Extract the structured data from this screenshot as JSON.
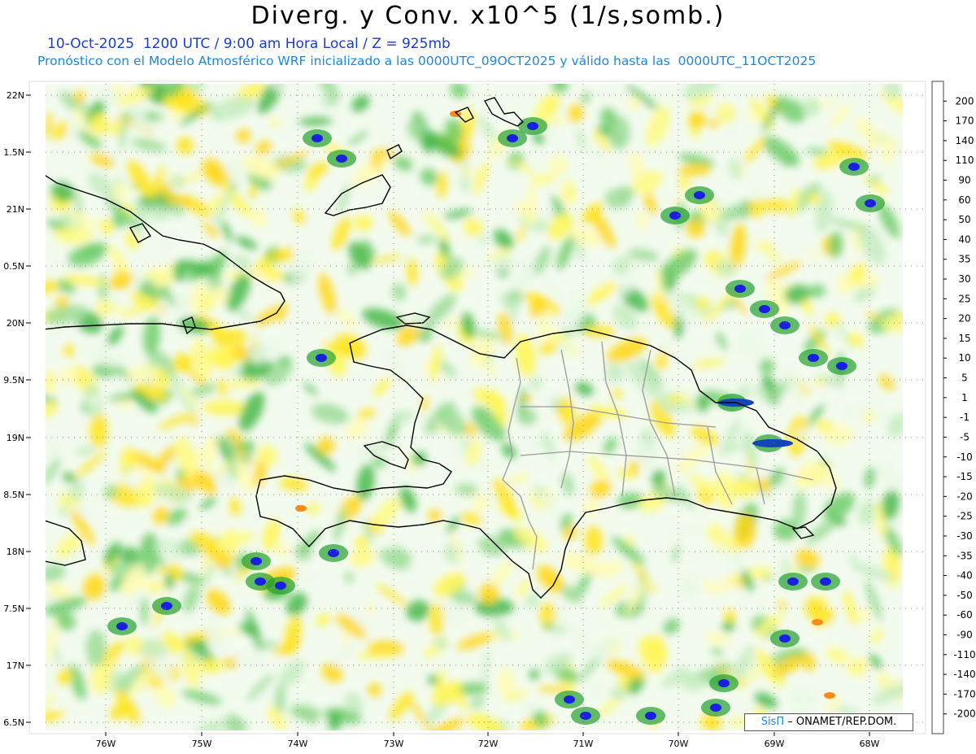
{
  "header": {
    "title": "Diverg. y Conv. x10^5 (1/s,somb.)",
    "line1": "10-Oct-2025  1200 UTC / 9:00 am Hora Local / Z = 925mb",
    "line2": "Pronóstico con el Modelo Atmosférico WRF inicializado a las 0000UTC_09OCT2025 y válido hasta las  0000UTC_11OCT2025"
  },
  "axes": {
    "lat_labels": [
      "22N",
      "1.5N",
      "21N",
      "0.5N",
      "20N",
      "9.5N",
      "19N",
      "8.5N",
      "18N",
      "7.5N",
      "17N",
      "6.5N"
    ],
    "lon_labels": [
      "76W",
      "75W",
      "74W",
      "73W",
      "72W",
      "71W",
      "70W",
      "69W",
      "68W"
    ]
  },
  "colorbar": {
    "labels": [
      "200",
      "170",
      "140",
      "110",
      "90",
      "60",
      "50",
      "40",
      "35",
      "30",
      "25",
      "20",
      "15",
      "10",
      "5",
      "1",
      "-1",
      "-5",
      "-10",
      "-15",
      "-20",
      "-25",
      "-30",
      "-35",
      "-40",
      "-50",
      "-60",
      "-90",
      "-110",
      "-140",
      "-170",
      "-200"
    ],
    "colors": [
      "#e5001a",
      "#f52820",
      "#ff4a1e",
      "#ff6a1c",
      "#ff8a18",
      "#ffa416",
      "#ffb414",
      "#ffc812",
      "#ffd610",
      "#ffe414",
      "#fff01c",
      "#fff650",
      "#fffa80",
      "#fffcb0",
      "#fffed8",
      "#ffffff",
      "#eaf8e6",
      "#c4ecc0",
      "#9cdc96",
      "#72cc6c",
      "#48b84a",
      "#22a030",
      "#0a8a2a",
      "#0b7a5a",
      "#0f6690",
      "#1246b8",
      "#1a20e0",
      "#2414d8",
      "#3010c0",
      "#3a0ea8",
      "#44108f",
      "#4e1080",
      "#5a0c78"
    ]
  },
  "credit": {
    "brand": "SisΠ",
    "text": " – ONAMET/REP.DOM."
  }
}
